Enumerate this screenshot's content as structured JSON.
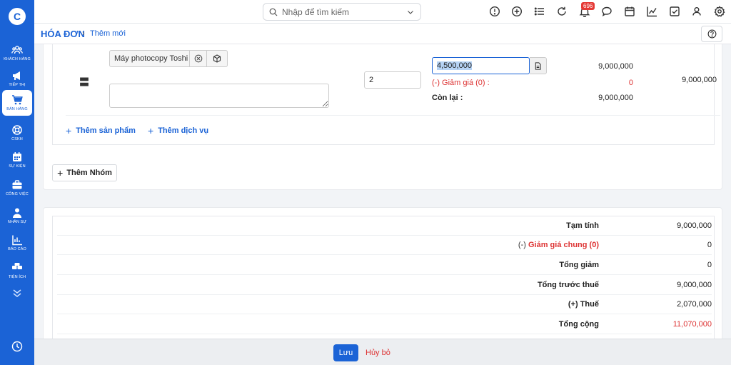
{
  "sidebar": {
    "logo_glyph": "C",
    "items": [
      {
        "label": "KHÁCH HÀNG",
        "icon": "users-icon"
      },
      {
        "label": "TIẾP THỊ",
        "icon": "megaphone-icon"
      },
      {
        "label": "BÁN HÀNG",
        "icon": "cart-icon",
        "active": true
      },
      {
        "label": "CSKH",
        "icon": "lifebuoy-icon"
      },
      {
        "label": "SỰ KIỆN",
        "icon": "calendar-icon"
      },
      {
        "label": "CÔNG VIỆC",
        "icon": "briefcase-icon"
      },
      {
        "label": "NHÂN SỰ",
        "icon": "person-icon"
      },
      {
        "label": "BÁO CÁO",
        "icon": "chart-icon"
      },
      {
        "label": "TIỆN ÍCH",
        "icon": "boxes-icon"
      }
    ]
  },
  "topbar": {
    "search_placeholder": "Nhập để tìm kiếm",
    "notification_count": "696"
  },
  "breadcrumb": {
    "title": "HÓA ĐƠN",
    "separator": "›",
    "current": "Thêm mới"
  },
  "line_item": {
    "product_name": "Máy photocopy Toshi",
    "description": "",
    "quantity": "2",
    "unit_price": "4,500,000",
    "subtotal": "9,000,000",
    "discount_label": "(-) Giảm giá (0) :",
    "discount_value": "0",
    "remaining_label": "Còn lại :",
    "remaining_value": "9,000,000",
    "line_total": "9,000,000"
  },
  "actions": {
    "add_product": "Thêm sản phẩm",
    "add_service": "Thêm dịch vụ",
    "add_group": "Thêm Nhóm"
  },
  "summary": {
    "subtotal_label": "Tạm tính",
    "subtotal_value": "9,000,000",
    "general_discount_prefix": "(-)",
    "general_discount_label": "Giảm giá chung (0)",
    "general_discount_value": "0",
    "total_discount_label": "Tổng giảm",
    "total_discount_value": "0",
    "pre_tax_label": "Tổng trước thuế",
    "pre_tax_value": "9,000,000",
    "tax_label": "(+) Thuế",
    "tax_value": "2,070,000",
    "grand_total_label": "Tổng cộng",
    "grand_total_value": "11,070,000"
  },
  "footer": {
    "save_label": "Lưu",
    "cancel_label": "Hủy bỏ"
  },
  "colors": {
    "brand": "#1b63d6",
    "danger": "#d33",
    "badge": "#e53935"
  }
}
